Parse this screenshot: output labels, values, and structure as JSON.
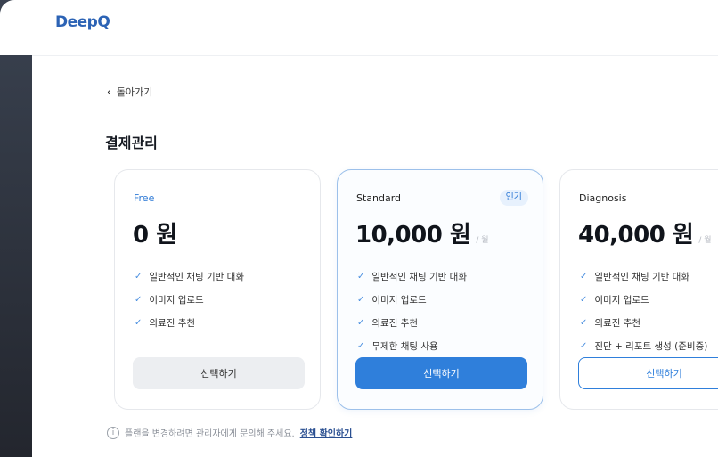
{
  "header": {
    "logo": "DeepQ"
  },
  "nav": {
    "back_label": "돌아가기"
  },
  "page": {
    "title": "결제관리"
  },
  "plans": [
    {
      "name": "Free",
      "price": "0 원",
      "period": "",
      "features": [
        "일반적인 채팅 기반 대화",
        "이미지 업로드",
        "의료진 추천"
      ],
      "button": "선택하기"
    },
    {
      "name": "Standard",
      "badge": "인기",
      "price": "10,000 원",
      "period": "/ 월",
      "features": [
        "일반적인 채팅 기반 대화",
        "이미지 업로드",
        "의료진 추천",
        "무제한 채팅 사용"
      ],
      "button": "선택하기"
    },
    {
      "name": "Diagnosis",
      "price": "40,000 원",
      "period": "/ 월",
      "features": [
        "일반적인 채팅 기반 대화",
        "이미지 업로드",
        "의료진 추천",
        "진단 + 리포트 생성 (준비중)"
      ],
      "button": "선택하기"
    }
  ],
  "footer": {
    "notice": "플랜을 변경하려면 관리자에게 문의해 주세요.",
    "link": "정책 확인하기"
  },
  "colors": {
    "accent": "#2f7fdb",
    "logo": "#2c63b5",
    "badge_bg": "#e7f1fd"
  }
}
